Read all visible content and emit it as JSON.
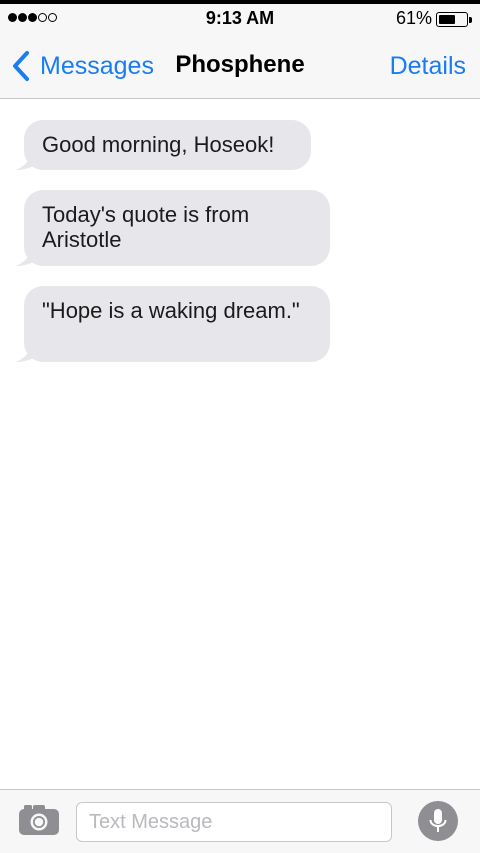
{
  "status_bar": {
    "signal_filled": 3,
    "signal_total": 5,
    "time": "9:13 AM",
    "battery_percent_text": "61%",
    "battery_level": 0.61
  },
  "nav": {
    "back_label": "Messages",
    "title": "Phosphene",
    "details_label": "Details",
    "accent_color": "#1a7cf2"
  },
  "messages": [
    {
      "text": "Good morning, Hoseok!"
    },
    {
      "text": "Today's quote is from Aristotle"
    },
    {
      "text": "\"Hope is a waking dream.\""
    }
  ],
  "input_bar": {
    "placeholder": "Text Message",
    "left_icon": "camera-icon",
    "right_icon": "microphone-icon"
  },
  "colors": {
    "incoming_bubble": "#e6e6eb",
    "bar_background": "#f7f7f8"
  }
}
